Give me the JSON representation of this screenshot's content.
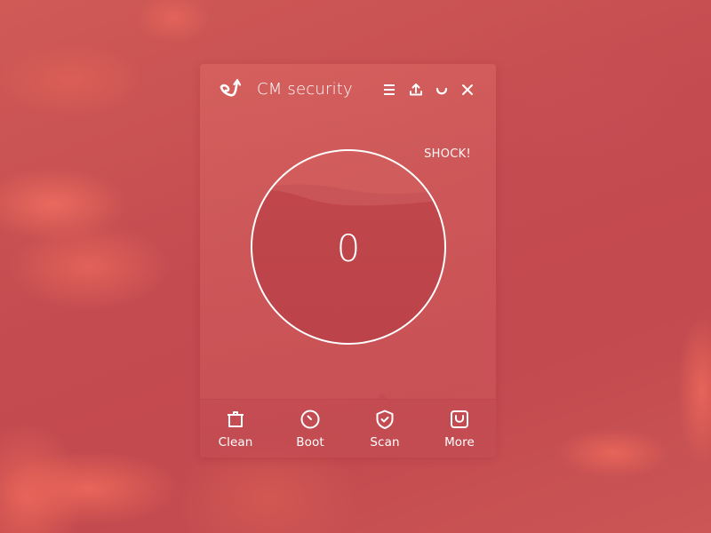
{
  "app": {
    "title": "CM security",
    "logo_icon": "cm-swirl-arrow-logo"
  },
  "titlebar": {
    "buttons": [
      {
        "name": "menu",
        "icon": "hamburger-menu-icon"
      },
      {
        "name": "share",
        "icon": "upload-icon"
      },
      {
        "name": "minimize",
        "icon": "minimize-curve-icon"
      },
      {
        "name": "close",
        "icon": "close-icon"
      }
    ]
  },
  "main": {
    "status_text": "SHOCK!",
    "gauge": {
      "value": "0"
    }
  },
  "bottom_nav": {
    "active_index": 2,
    "items": [
      {
        "label": "Clean",
        "icon": "trash-can-icon"
      },
      {
        "label": "Boot",
        "icon": "speedometer-icon"
      },
      {
        "label": "Scan",
        "icon": "shield-check-icon"
      },
      {
        "label": "More",
        "icon": "bag-icon"
      }
    ]
  },
  "colors": {
    "background": "#c74f52",
    "accent_white": "#ffffff",
    "gauge_fill": "#bd4549"
  }
}
